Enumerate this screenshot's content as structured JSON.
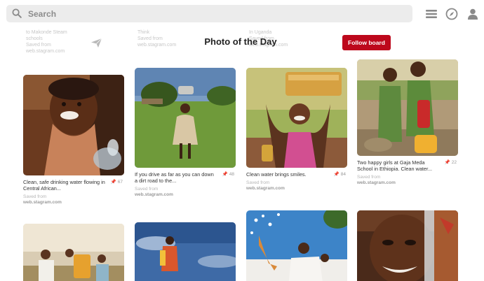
{
  "search": {
    "placeholder": "Search"
  },
  "header_icons": [
    "menu-icon",
    "compass-icon",
    "profile-icon"
  ],
  "faded_strip": [
    {
      "line1": "to Makonde Steam",
      "line2": "schools",
      "line3": "Saved from",
      "line4": "web.stagram.com"
    },
    {
      "line1": "Think",
      "line2": "Saved from",
      "line3": "web.stagram.com"
    },
    {
      "line1": "In Uganda",
      "line2": "Saved from",
      "line3": "web.stagram.com"
    }
  ],
  "board": {
    "title": "Photo of the Day",
    "follow_label": "Follow board"
  },
  "colors": {
    "accent": "#bd081c"
  },
  "pins": [
    {
      "description": "Clean, safe drinking water flowing in Central African...",
      "repins": "67",
      "saved_label": "Saved from",
      "source": "web.stagram.com"
    },
    {
      "description": "If you drive as far as you can down a dirt road to the...",
      "repins": "48",
      "saved_label": "Saved from",
      "source": "web.stagram.com"
    },
    {
      "description": "Clean water brings smiles.",
      "repins": "84",
      "saved_label": "Saved from",
      "source": "web.stagram.com"
    },
    {
      "description": "Two happy girls at Gaja Meda School in Ethiopia. Clean water...",
      "repins": "22",
      "saved_label": "Saved from",
      "source": "web.stagram.com"
    }
  ]
}
